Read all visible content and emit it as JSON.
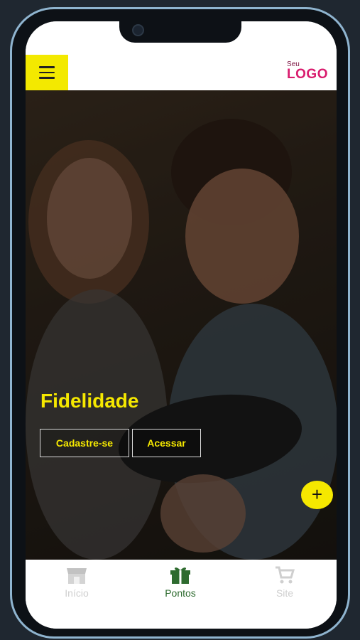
{
  "header": {
    "menu_icon": "hamburger-menu-icon",
    "logo_small": "Seu",
    "logo_big": "LOGO"
  },
  "hero": {
    "title": "Fidelidade",
    "buttons": {
      "cadastre": "Cadastre-se",
      "acessar": "Acessar"
    },
    "fab_label": "+"
  },
  "bottom_nav": {
    "items": [
      {
        "label": "Início",
        "icon": "store-icon",
        "active": false
      },
      {
        "label": "Pontos",
        "icon": "gift-icon",
        "active": true
      },
      {
        "label": "Site",
        "icon": "cart-icon",
        "active": false
      }
    ]
  },
  "colors": {
    "accent": "#f5e800",
    "active_nav": "#2e6b2f",
    "logo": "#d91c6e",
    "frame": "#8fb4cf"
  }
}
